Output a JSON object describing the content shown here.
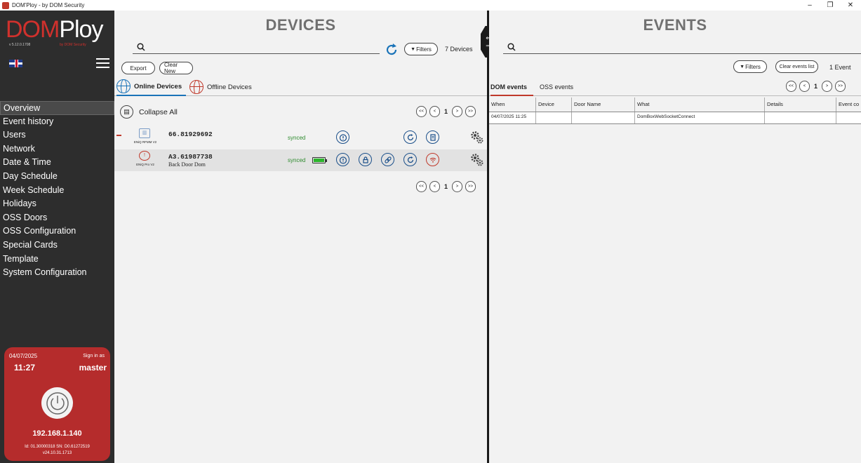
{
  "window": {
    "title": "DOM'Ploy - by DOM Security"
  },
  "sidebar": {
    "logo_dom": "DOM",
    "logo_ploy": "Ploy",
    "version": "v 5.12.0.1708",
    "by_label": "by DOM Security",
    "nav_items": [
      {
        "label": "Overview",
        "active": true
      },
      {
        "label": "Event history"
      },
      {
        "label": "Users"
      },
      {
        "label": "Network"
      },
      {
        "label": "Date & Time"
      },
      {
        "label": "Day Schedule"
      },
      {
        "label": "Week Schedule"
      },
      {
        "label": "Holidays"
      },
      {
        "label": "OSS Doors"
      },
      {
        "label": "OSS Configuration"
      },
      {
        "label": "Special Cards"
      },
      {
        "label": "Template"
      },
      {
        "label": "System Configuration"
      }
    ],
    "session": {
      "date": "04/07/2025",
      "time": "11:27",
      "sign_in_label": "Sign in as",
      "user": "master",
      "ip": "192.168.1.140",
      "ids_line": "Id: 01.30000318   SN: D0.61272519",
      "firmware": "v24.10.31.1713"
    }
  },
  "devices": {
    "title": "DEVICES",
    "search_placeholder": "",
    "filters_label": "Filters",
    "count_label": "7 Devices",
    "export_label": "Export",
    "clear_new_label": "Clear New",
    "tabs": [
      {
        "label": "Online Devices",
        "active": true
      },
      {
        "label": "Offline Devices"
      }
    ],
    "collapse_label": "Collapse All",
    "pager": {
      "first": "<<",
      "prev": "<",
      "page": "1",
      "next": ">",
      "last": ">>"
    },
    "rows": [
      {
        "type": "ENiQ RFMM V2",
        "name": "66.81929692",
        "sub": "",
        "status": "synced"
      },
      {
        "type": "ENiQ Pro V2",
        "name": "A3.61987738",
        "sub": "Back Door Dom",
        "status": "synced",
        "battery": 1.0
      }
    ]
  },
  "events": {
    "title": "EVENTS",
    "search_placeholder": "",
    "filters_label": "Filters",
    "clear_label": "Clear events list",
    "count_label": "1 Event",
    "tabs": [
      {
        "label": "DOM events",
        "active": true
      },
      {
        "label": "OSS events"
      }
    ],
    "pager": {
      "first": "<<",
      "prev": "<",
      "page": "1",
      "next": ">",
      "last": ">>"
    },
    "columns": [
      "When",
      "Device",
      "Door Name",
      "What",
      "Details",
      "Event co"
    ],
    "rows": [
      [
        "04/07/2025 11:25",
        "",
        "",
        "DomBoxWebSocketConnect",
        "",
        ""
      ]
    ]
  },
  "colors": {
    "brand_red": "#d0312d",
    "sidebar_bg": "#2d2d2d",
    "accent_blue": "#1a73b8",
    "synced_green": "#2e8b2e"
  }
}
